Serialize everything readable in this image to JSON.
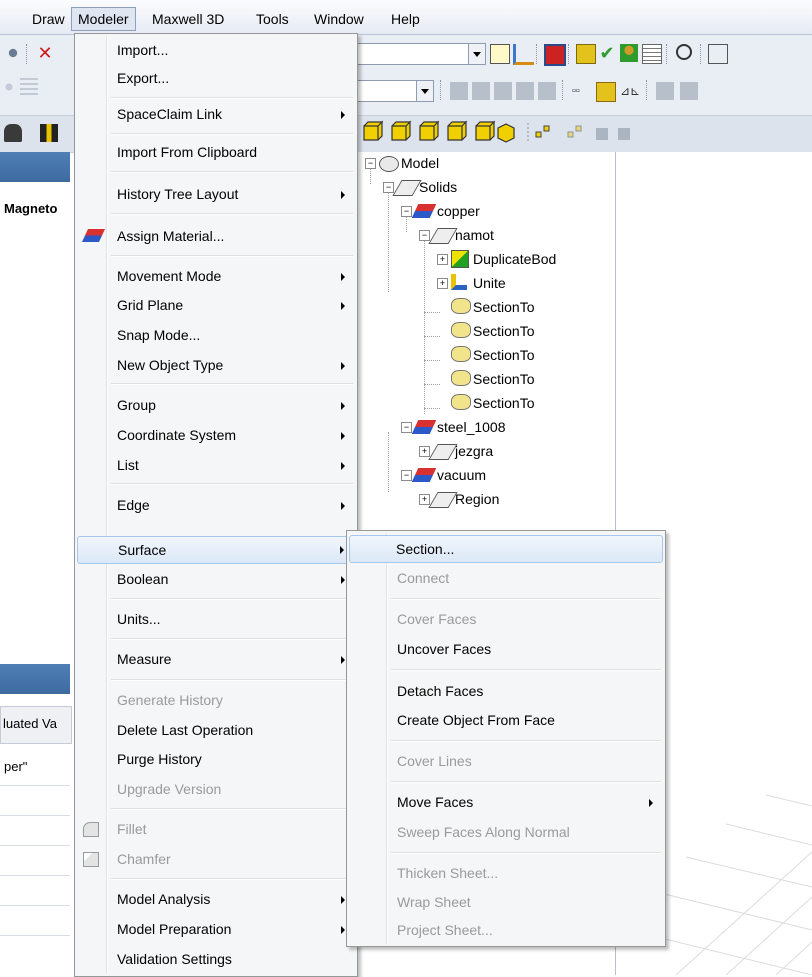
{
  "menubar": {
    "items": [
      "Draw",
      "Modeler",
      "Maxwell 3D",
      "Tools",
      "Window",
      "Help"
    ]
  },
  "left_panel": {
    "project_partial": "Magneto",
    "column_partial": "luated Va",
    "value_partial": "per\""
  },
  "tree": {
    "root": "Model",
    "solids": "Solids",
    "copper": "copper",
    "namot": "namot",
    "duplicate": "DuplicateBod",
    "unite": "Unite",
    "section_items": [
      "SectionTo",
      "SectionTo",
      "SectionTo",
      "SectionTo",
      "SectionTo"
    ],
    "steel": "steel_1008",
    "jezgra": "jezgra",
    "vacuum": "vacuum",
    "region": "Region"
  },
  "modeler_menu": {
    "items": [
      "Import...",
      "Export...",
      "SpaceClaim Link",
      "Import From Clipboard",
      "History Tree Layout",
      "Assign Material...",
      "Movement Mode",
      "Grid Plane",
      "Snap Mode...",
      "New Object Type",
      "Group",
      "Coordinate System",
      "List",
      "Edge",
      "Surface",
      "Boolean",
      "Units...",
      "Measure",
      "Generate History",
      "Delete Last Operation",
      "Purge History",
      "Upgrade Version",
      "Fillet",
      "Chamfer",
      "Model Analysis",
      "Model Preparation",
      "Validation Settings"
    ]
  },
  "surface_submenu": {
    "items": [
      "Section...",
      "Connect",
      "Cover Faces",
      "Uncover Faces",
      "Detach Faces",
      "Create Object From Face",
      "Cover Lines",
      "Move Faces",
      "Sweep Faces Along Normal",
      "Thicken Sheet...",
      "Wrap Sheet",
      "Project Sheet..."
    ]
  },
  "colors": {
    "menu_bg": "#f5f6f7",
    "highlight": "#dbe8f7",
    "disabled_text": "#9a9a9a",
    "panel_header": "#3e6aa0"
  }
}
